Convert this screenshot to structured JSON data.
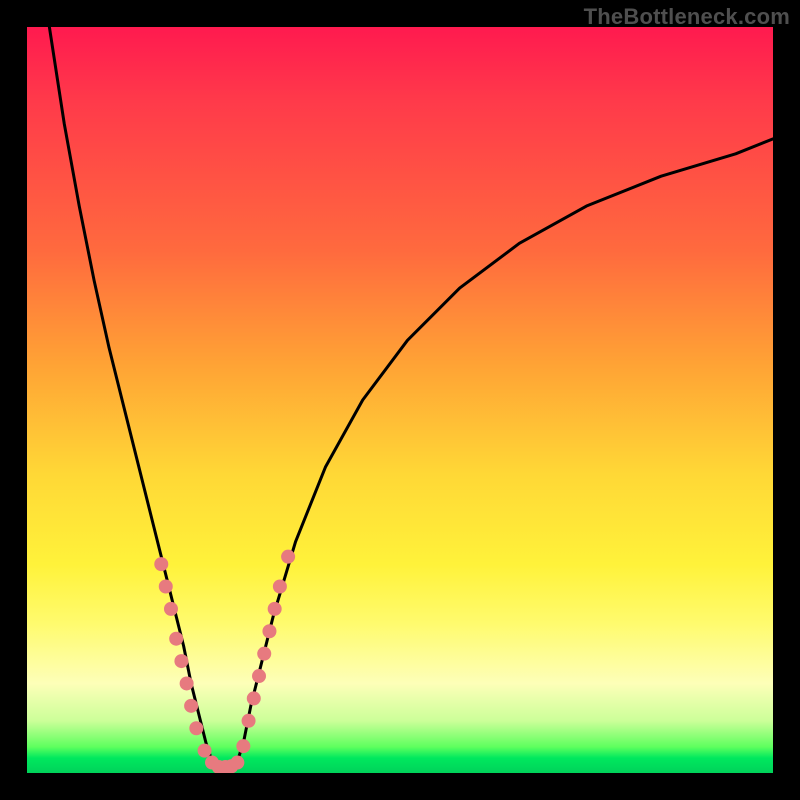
{
  "watermark": "TheBottleneck.com",
  "chart_data": {
    "type": "line",
    "title": "",
    "xlabel": "",
    "ylabel": "",
    "xlim": [
      0,
      100
    ],
    "ylim": [
      0,
      100
    ],
    "note": "Decorative bottleneck V-curve over a red→green heat gradient; axes are unlabeled in the source image so values are normalized 0–100.",
    "series": [
      {
        "name": "left-branch",
        "x": [
          3,
          5,
          7,
          9,
          11,
          13,
          15,
          17,
          18,
          19,
          20,
          21,
          22,
          23,
          24,
          25
        ],
        "y": [
          100,
          87,
          76,
          66,
          57,
          49,
          41,
          33,
          29,
          25,
          21,
          17,
          12,
          8,
          4,
          1
        ]
      },
      {
        "name": "right-branch",
        "x": [
          28,
          29,
          30,
          31,
          33,
          36,
          40,
          45,
          51,
          58,
          66,
          75,
          85,
          95,
          100
        ],
        "y": [
          1,
          4,
          9,
          13,
          21,
          31,
          41,
          50,
          58,
          65,
          71,
          76,
          80,
          83,
          85
        ]
      },
      {
        "name": "valley-floor",
        "x": [
          25,
          26,
          27,
          28
        ],
        "y": [
          1,
          0.5,
          0.5,
          1
        ]
      }
    ],
    "scatter_overlay": {
      "name": "salmon-dots",
      "color": "#e77a7f",
      "points": [
        {
          "x": 18.0,
          "y": 28
        },
        {
          "x": 18.6,
          "y": 25
        },
        {
          "x": 19.3,
          "y": 22
        },
        {
          "x": 20.0,
          "y": 18
        },
        {
          "x": 20.7,
          "y": 15
        },
        {
          "x": 21.4,
          "y": 12
        },
        {
          "x": 22.0,
          "y": 9
        },
        {
          "x": 22.7,
          "y": 6
        },
        {
          "x": 23.8,
          "y": 3
        },
        {
          "x": 24.8,
          "y": 1.4
        },
        {
          "x": 25.7,
          "y": 0.8
        },
        {
          "x": 26.6,
          "y": 0.8
        },
        {
          "x": 27.4,
          "y": 0.9
        },
        {
          "x": 28.2,
          "y": 1.4
        },
        {
          "x": 29.0,
          "y": 3.6
        },
        {
          "x": 29.7,
          "y": 7
        },
        {
          "x": 30.4,
          "y": 10
        },
        {
          "x": 31.1,
          "y": 13
        },
        {
          "x": 31.8,
          "y": 16
        },
        {
          "x": 32.5,
          "y": 19
        },
        {
          "x": 33.2,
          "y": 22
        },
        {
          "x": 33.9,
          "y": 25
        },
        {
          "x": 35.0,
          "y": 29
        }
      ]
    }
  },
  "colors": {
    "curve": "#000000",
    "dots": "#e77a7f",
    "frame": "#000000"
  }
}
